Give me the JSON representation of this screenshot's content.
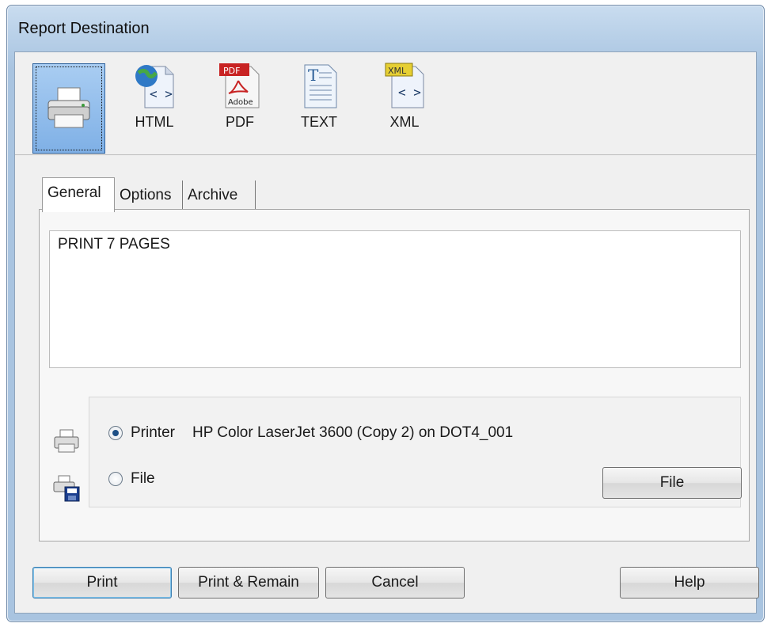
{
  "window": {
    "title": "Report Destination"
  },
  "toolbar": {
    "items": [
      {
        "id": "printer",
        "label": "",
        "icon": "printer-icon",
        "selected": true
      },
      {
        "id": "html",
        "label": "HTML",
        "icon": "html-globe-icon",
        "selected": false
      },
      {
        "id": "pdf",
        "label": "PDF",
        "icon": "pdf-adobe-icon",
        "selected": false
      },
      {
        "id": "text",
        "label": "TEXT",
        "icon": "text-document-icon",
        "selected": false
      },
      {
        "id": "xml",
        "label": "XML",
        "icon": "xml-document-icon",
        "selected": false
      }
    ],
    "pdf_badge": "PDF",
    "pdf_logo": "Adobe",
    "xml_badge": "XML"
  },
  "tabs": [
    {
      "label": "General",
      "active": true
    },
    {
      "label": "Options",
      "active": false
    },
    {
      "label": "Archive",
      "active": false
    }
  ],
  "general": {
    "summary_text": "PRINT 7 PAGES",
    "printer_option": {
      "label": "Printer",
      "value": "HP Color LaserJet 3600 (Copy 2) on DOT4_001",
      "selected": true
    },
    "file_option": {
      "label": "File",
      "selected": false
    },
    "file_button_label": "File"
  },
  "buttons": {
    "print": "Print",
    "print_remain": "Print & Remain",
    "cancel": "Cancel",
    "help": "Help"
  },
  "colors": {
    "title_bar": "#b8d0e8",
    "selected_tool": "#7fb0e6",
    "radio_selected": "#1d4f86"
  }
}
